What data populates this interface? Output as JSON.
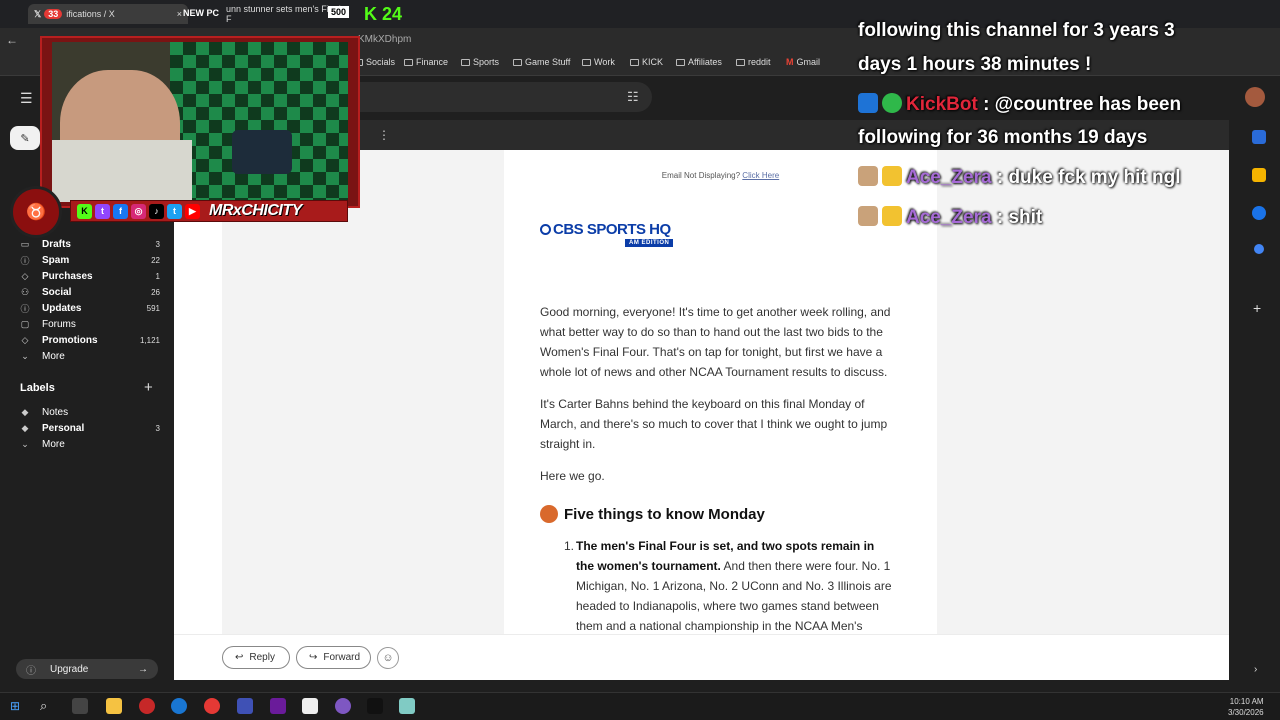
{
  "browser": {
    "tabs": [
      {
        "label": "ifications / X",
        "badge": "33"
      },
      {
        "label": "unn stunner sets men's Final F"
      }
    ],
    "url_fragment": "KMkXDhpm",
    "bookmarks": [
      "Socials",
      "Finance",
      "Sports",
      "Game Stuff",
      "Work",
      "KICK",
      "Affiliates",
      "reddit",
      "Gmail"
    ]
  },
  "gmail": {
    "nav": [
      {
        "label": "Drafts",
        "count": "3",
        "icon": "draft-icon"
      },
      {
        "label": "Spam",
        "count": "22",
        "icon": "spam-icon"
      },
      {
        "label": "Purchases",
        "count": "1",
        "icon": "tag-icon"
      },
      {
        "label": "Social",
        "count": "26",
        "icon": "people-icon"
      },
      {
        "label": "Updates",
        "count": "591",
        "icon": "info-icon"
      },
      {
        "label": "Forums",
        "count": "",
        "icon": "chat-icon"
      },
      {
        "label": "Promotions",
        "count": "1,121",
        "icon": "tag-icon"
      },
      {
        "label": "More",
        "count": "",
        "icon": "chevron-down-icon"
      }
    ],
    "labels_heading": "Labels",
    "labels": [
      {
        "label": "Notes",
        "count": ""
      },
      {
        "label": "Personal",
        "count": "3"
      },
      {
        "label": "More",
        "count": ""
      }
    ],
    "upgrade_label": "Upgrade",
    "reply_label": "Reply",
    "forward_label": "Forward"
  },
  "email": {
    "not_displaying": "Email Not Displaying?",
    "click_here": "Click Here",
    "logo": "CBS SPORTS HQ",
    "logo_sub": "AM EDITION",
    "para1": "Good morning, everyone! It's time to get another week rolling, and what better way to do so than to hand out the last two bids to the Women's Final Four. That's on tap for tonight, but first we have a whole lot of news and other NCAA Tournament results to discuss.",
    "para2": "It's Carter Bahns behind the keyboard on this final Monday of March, and there's so much to cover that I think we ought to jump straight in.",
    "para3": "Here we go.",
    "section_title": "Five things to know Monday",
    "item1_num": "1.",
    "item1_bold": "The men's Final Four is set, and two spots remain in the women's tournament.",
    "item1_text": " And then there were four. No. 1 Michigan, No. 1 Arizona, No. 2 UConn and No. 3 Illinois are headed to Indianapolis, where two games stand between them and a national championship in the NCAA Men's"
  },
  "overlay": {
    "newpc": "NEW PC",
    "count": "500",
    "kick_count": "24",
    "handle": "MRxCHICITY",
    "chat": [
      {
        "user": "",
        "text": "following this channel for 3 years 3"
      },
      {
        "user": "",
        "text": "days 1 hours 38 minutes !"
      },
      {
        "user": "KickBot",
        "text": " : @countree has been"
      },
      {
        "user": "",
        "text": "following for 36 months 19 days"
      },
      {
        "user": "Ace_Zera",
        "text": " : duke fck my hit ngl"
      },
      {
        "user": "Ace_Zera",
        "text": " : shit"
      }
    ]
  },
  "taskbar": {
    "time": "10:10 AM",
    "date": "3/30/2026"
  },
  "colors": {
    "cbs_blue": "#0b3da8",
    "kick_green": "#53fc18",
    "kickbot_red": "#e0263a",
    "ace_purple": "#a66bd6"
  }
}
